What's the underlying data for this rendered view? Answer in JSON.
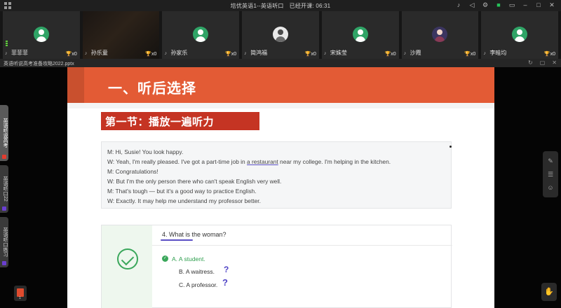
{
  "topbar": {
    "class_title": "培优英语1--英语听口",
    "elapsed_label": "已经开课:",
    "elapsed_time": "06:31"
  },
  "participants": [
    {
      "name": "菲菲菲",
      "trophy": "x0",
      "avatar": "default-avatar"
    },
    {
      "name": "孙乐童",
      "trophy": "x0",
      "avatar": "camera-video"
    },
    {
      "name": "孙家乐",
      "trophy": "x0",
      "avatar": "default-avatar"
    },
    {
      "name": "简鸿福",
      "trophy": "x0",
      "avatar": "photo-avatar"
    },
    {
      "name": "宋姝莹",
      "trophy": "x0",
      "avatar": "default-avatar"
    },
    {
      "name": "沙霞",
      "trophy": "x0",
      "avatar": "anime-avatar"
    },
    {
      "name": "李畦均",
      "trophy": "x0",
      "avatar": "default-avatar"
    }
  ],
  "document": {
    "filename": "英语听说高考准备攻略2022.pptx"
  },
  "left_tabs": [
    {
      "label": "英语听说高考"
    },
    {
      "label": "英语听口22"
    },
    {
      "label": "英语听口练习"
    }
  ],
  "slide": {
    "heading": "一、听后选择",
    "section": "第一节：播放一遍听力",
    "dialog": [
      "M: Hi, Susie! You look happy.",
      "W: Yeah, I'm really pleased. I've got a part-time job in a restaurant near my college. I'm helping in the kitchen.",
      "M: Congratulations!",
      "W: But I'm the only person there who can't speak English very well.",
      "M: That's tough — but it's a good way to practice English.",
      "W: Exactly. It may help me understand my professor better."
    ],
    "dialog_line2_pre": "W: Yeah, I'm really pleased. I've got a part-time job in ",
    "dialog_line2_mark": "a restaurant",
    "dialog_line2_post": " near my college. I'm helping in the kitchen.",
    "question": "4. What is the woman?",
    "options": [
      {
        "text": "A. A student.",
        "correct": true
      },
      {
        "text": "B. A waitress.",
        "correct": false
      },
      {
        "text": "C. A professor.",
        "correct": false
      }
    ],
    "ink_marks": [
      "?",
      "?"
    ]
  },
  "colors": {
    "banner": "#e35b35",
    "section": "#c53423",
    "correct": "#3aa75b",
    "ink": "#5145c6"
  }
}
